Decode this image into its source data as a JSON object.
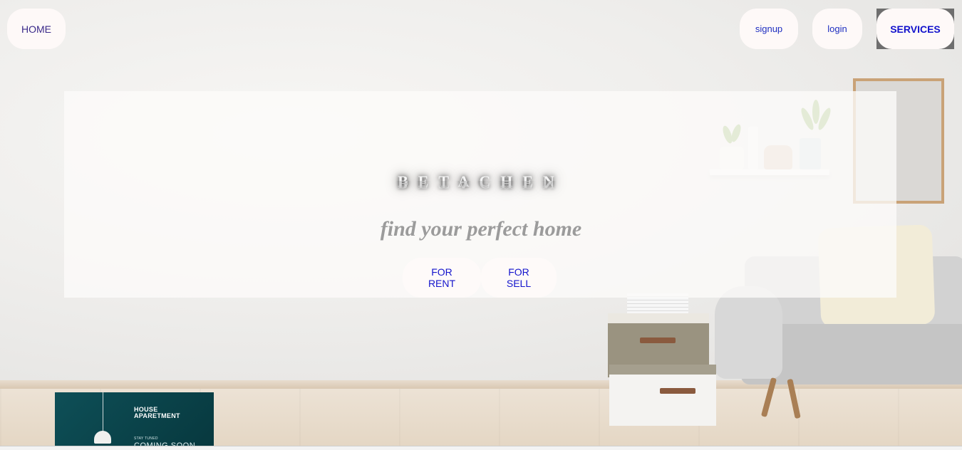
{
  "nav": {
    "home": "HOME",
    "signup": "signup",
    "login": "login",
    "services": "SERVICES"
  },
  "hero": {
    "brand": "BETACHEN",
    "tagline": "find your perfect home",
    "buttons": {
      "rent": "FOR RENT",
      "sell": "FOR SELL"
    }
  },
  "card": {
    "title": "HOUSE\nAPARETMENT",
    "subtitle": "STAY TUNED",
    "coming": "COMING SOON"
  },
  "colors": {
    "link_blue": "#1414cc",
    "button_bg": "#fefaf9",
    "tagline": "#9b9b9b",
    "card_teal": "#0e4f57"
  }
}
